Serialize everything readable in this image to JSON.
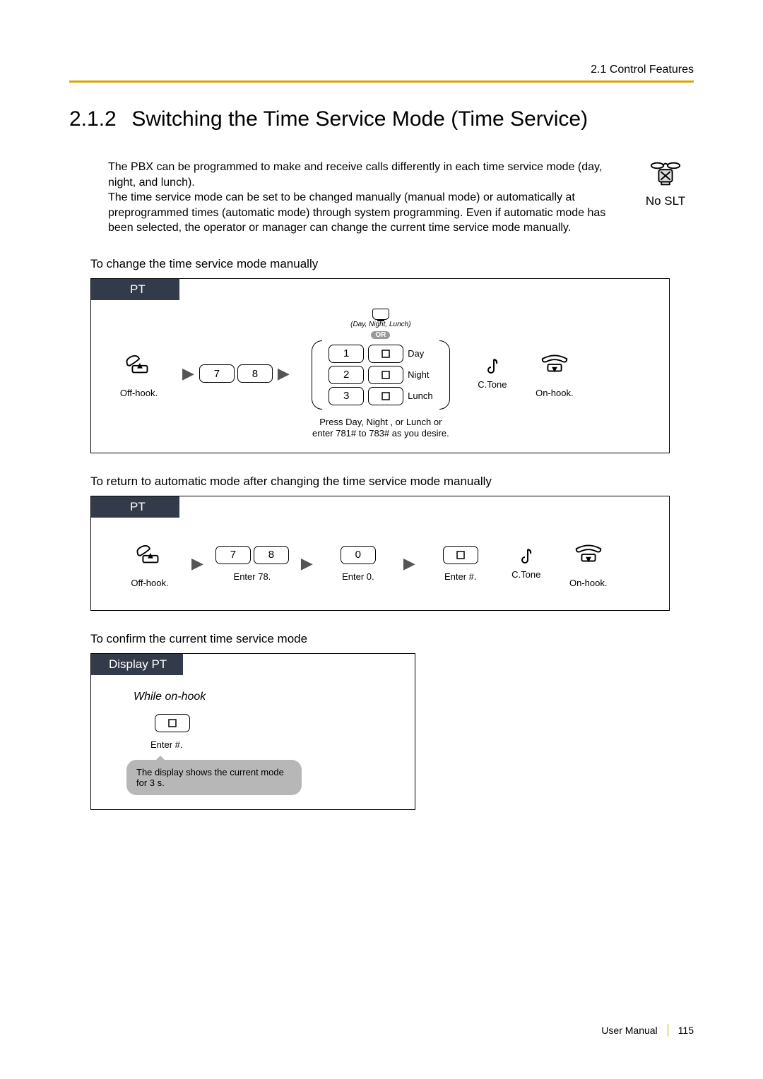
{
  "header": {
    "breadcrumb": "2.1 Control Features"
  },
  "section": {
    "number": "2.1.2",
    "title": "Switching the Time Service Mode (Time Service)"
  },
  "intro": {
    "p1": "The PBX can be programmed to make and receive calls differently in each time service mode (day, night, and lunch).",
    "p2": "The time service mode can be set to be changed manually (manual mode) or automatically at preprogrammed times (automatic mode) through system programming. Even if automatic mode has been selected, the operator or manager can change the current time service mode manually."
  },
  "noslt_label": "No SLT",
  "subheads": {
    "manual": "To change the time service mode manually",
    "auto": "To return to automatic mode after changing the time service mode manually",
    "confirm": "To confirm the current time service mode"
  },
  "tabs": {
    "pt": "PT",
    "display_pt": "Display PT"
  },
  "captions": {
    "offhook": "Off-hook.",
    "onhook": "On-hook.",
    "ctone": "C.Tone",
    "enter78": "Enter 78.",
    "enter0": "Enter 0.",
    "enterhash": "Enter #.",
    "press_or_enter1": "Press Day, Night , or Lunch  or",
    "press_or_enter2": "enter 781# to 783# as you desire."
  },
  "multiopt": {
    "top_label": "(Day, Night, Lunch)",
    "or": "OR",
    "rows": [
      {
        "digit": "1",
        "label": "Day"
      },
      {
        "digit": "2",
        "label": "Night"
      },
      {
        "digit": "3",
        "label": "Lunch"
      }
    ]
  },
  "keys": {
    "seven": "7",
    "eight": "8",
    "zero": "0"
  },
  "confirm_box": {
    "while_onhook": "While on-hook",
    "speech": "The display shows the current mode for 3 s."
  },
  "footer": {
    "label": "User Manual",
    "page": "115"
  }
}
